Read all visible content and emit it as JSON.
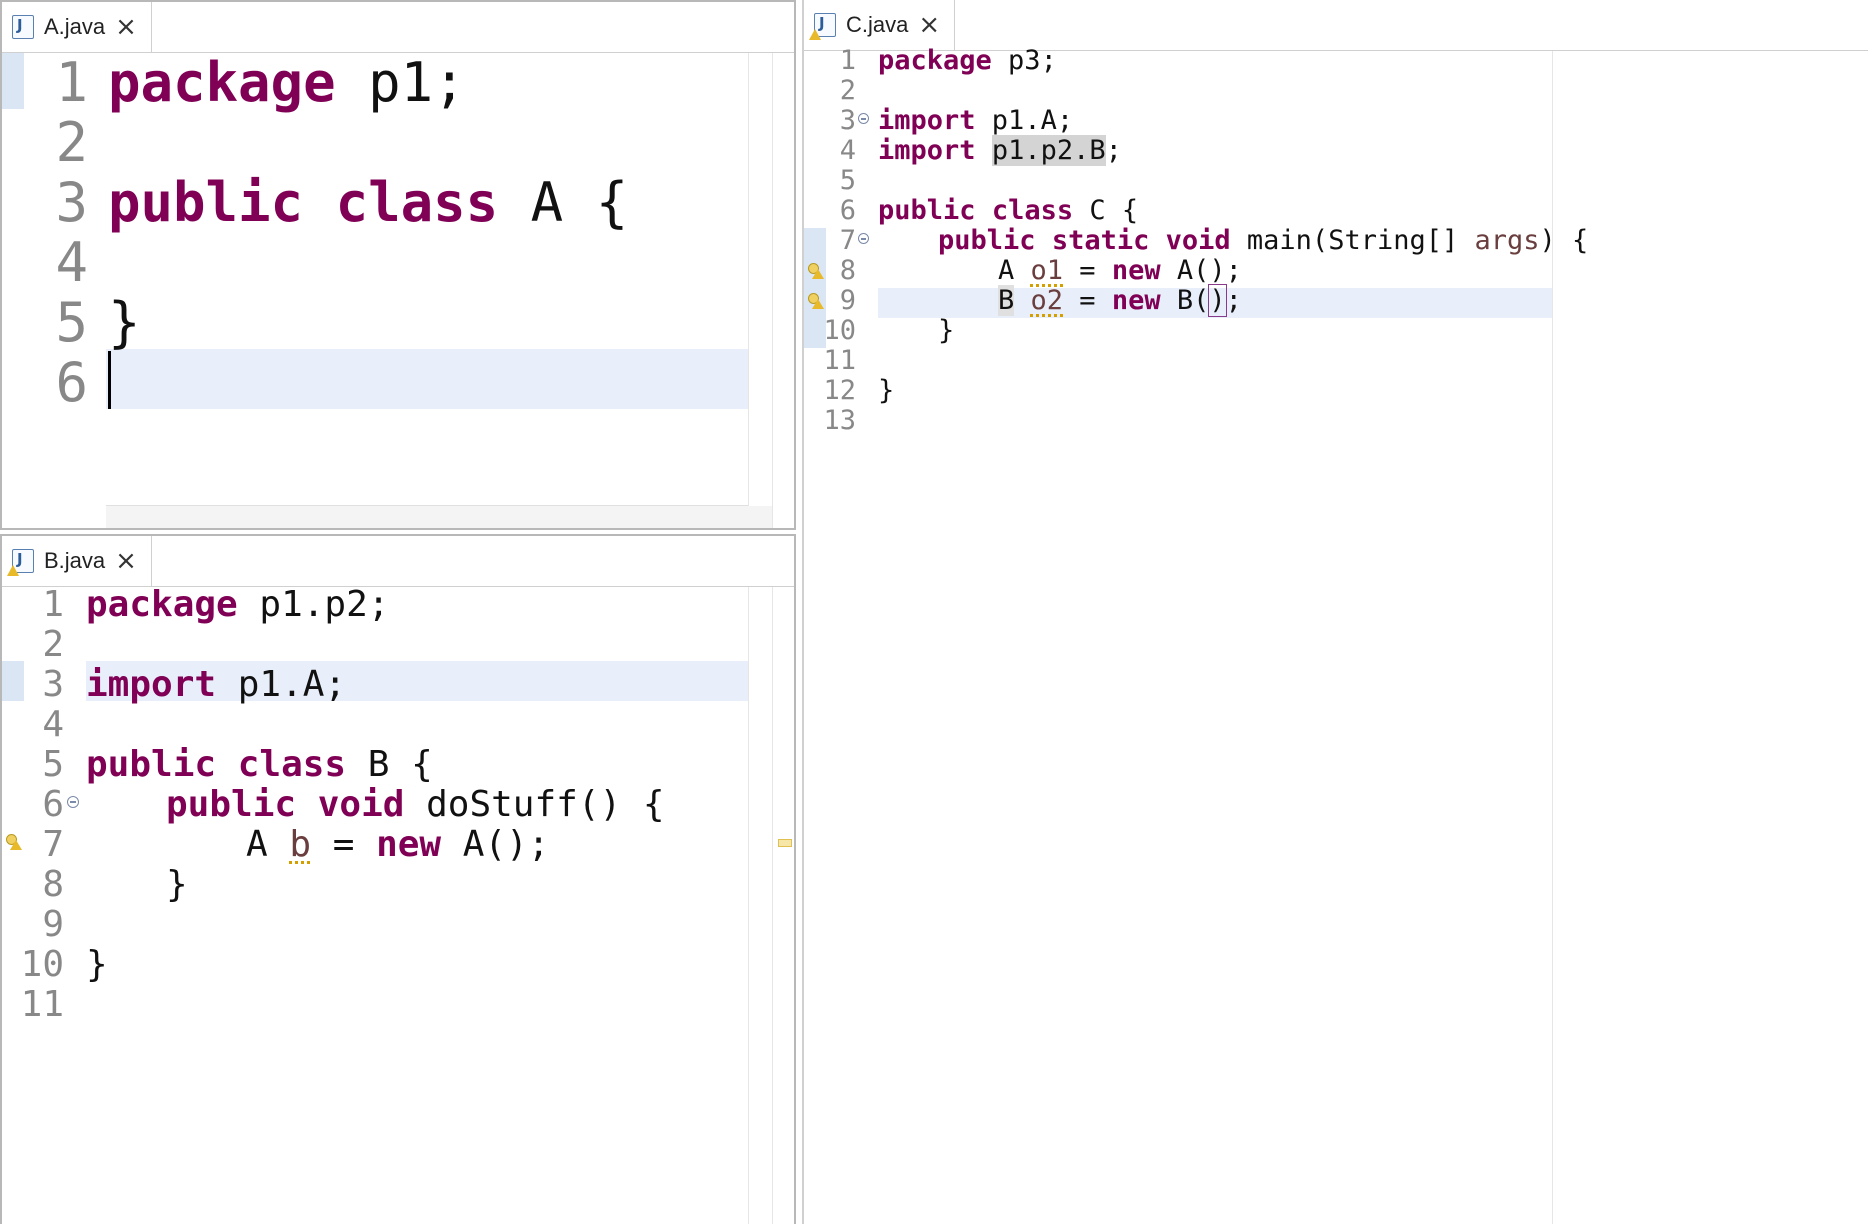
{
  "paneA": {
    "tab_title": "A.java",
    "close_glyph": "×",
    "lines": [
      "1",
      "2",
      "3",
      "4",
      "5",
      "6"
    ],
    "code": {
      "l1_kw": "package",
      "l1_rest": " p1;",
      "l3_kw1": "public",
      "l3_kw2": "class",
      "l3_rest": " A {",
      "l5": "}"
    }
  },
  "paneB": {
    "tab_title": "B.java",
    "close_glyph": "×",
    "lines": [
      "1",
      "2",
      "3",
      "4",
      "5",
      "6",
      "7",
      "8",
      "9",
      "10",
      "11"
    ],
    "code": {
      "l1_kw": "package",
      "l1_rest": " p1.p2;",
      "l3_kw": "import",
      "l3_rest": " p1.A;",
      "l5_kw1": "public",
      "l5_kw2": "class",
      "l5_rest": " B {",
      "l6_kw1": "public",
      "l6_kw2": "void",
      "l6_rest": " doStuff() {",
      "l7_a": "A ",
      "l7_var": "b",
      "l7_eq": " = ",
      "l7_kw": "new",
      "l7_rest": " A();",
      "l8": "}",
      "l10": "}"
    }
  },
  "paneC": {
    "tab_title": "C.java",
    "close_glyph": "×",
    "lines": [
      "1",
      "2",
      "3",
      "4",
      "5",
      "6",
      "7",
      "8",
      "9",
      "10",
      "11",
      "12",
      "13"
    ],
    "code": {
      "l1_kw": "package",
      "l1_rest": " p3;",
      "l3_kw": "import",
      "l3_rest": " p1.A;",
      "l4_kw": "import",
      "l4_sel": "p1.p2.B",
      "l4_end": ";",
      "l6_kw1": "public",
      "l6_kw2": "class",
      "l6_rest": " C {",
      "l7_kw1": "public",
      "l7_kw2": "static",
      "l7_kw3": "void",
      "l7_mid": " main(String[] ",
      "l7_var": "args",
      "l7_end": ") {",
      "l8_a": "A ",
      "l8_var": "o1",
      "l8_eq": " = ",
      "l8_kw": "new",
      "l8_rest": " A();",
      "l9_a": "B",
      "l9_sp": " ",
      "l9_var": "o2",
      "l9_eq": " = ",
      "l9_kw": "new",
      "l9_b": " B",
      "l9_op": "(",
      "l9_cp": ")",
      "l9_end": ";",
      "l10": "}",
      "l12": "}"
    }
  },
  "colors": {
    "keyword": "#7f0055",
    "variable": "#6a3e3e",
    "current_line": "#e8effb",
    "line_number": "#888888"
  }
}
